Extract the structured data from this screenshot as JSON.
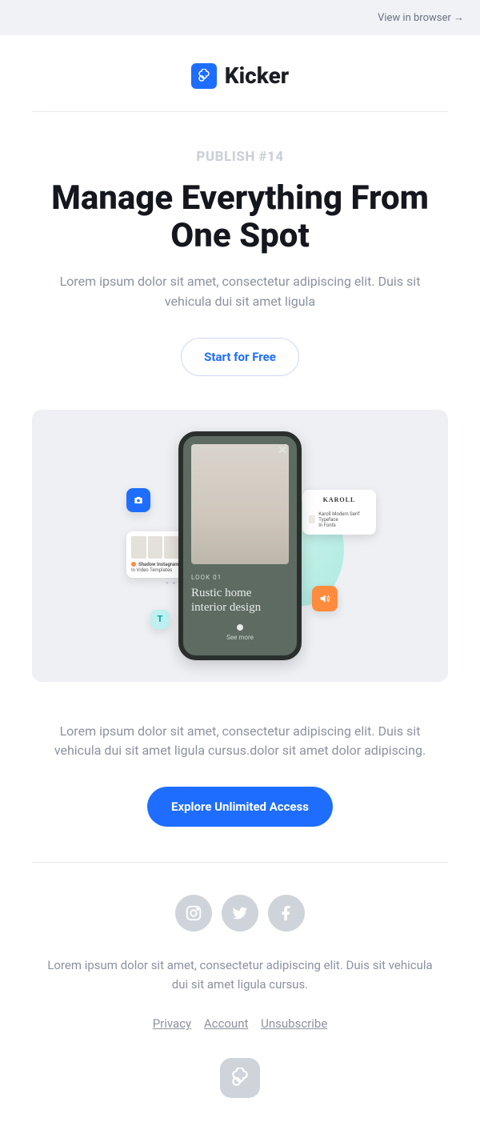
{
  "topbar": {
    "link": "View in browser →"
  },
  "brand": {
    "name": "Kicker"
  },
  "publish_tag": "PUBLISH #14",
  "headline": "Manage Everything From One Spot",
  "subhead": "Lorem ipsum dolor sit amet, consectetur adipiscing elit. Duis sit vehicula dui sit amet ligula",
  "cta_primary": "Start for Free",
  "hero": {
    "look_tag": "LOOK 01",
    "phone_title": "Rustic home interior design",
    "see_more": "See more",
    "card_left_title": "Shadow Instagram Stories",
    "card_left_sub": "In Video Templates",
    "card_right_brand": "KAROLL",
    "card_right_line": "Karoll Modern Serif Typeface",
    "card_right_sub": "In Fonts"
  },
  "description": "Lorem ipsum dolor sit amet, consectetur adipiscing elit. Duis sit vehicula dui sit amet ligula cursus.dolor sit amet dolor adipiscing.",
  "cta_secondary": "Explore Unlimited Access",
  "footer_text": "Lorem ipsum dolor sit amet, consectetur adipiscing elit. Duis sit vehicula dui sit amet ligula cursus.",
  "legal": {
    "privacy": "Privacy",
    "account": "Account",
    "unsubscribe": "Unsubscribe"
  }
}
